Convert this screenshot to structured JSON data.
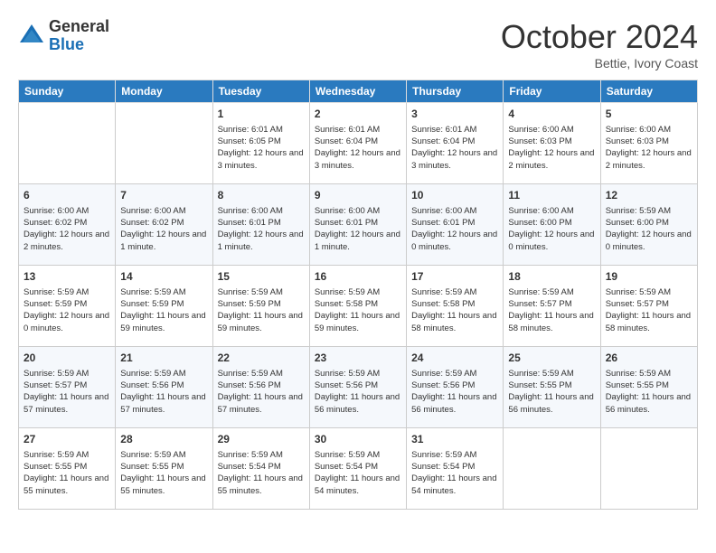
{
  "logo": {
    "general": "General",
    "blue": "Blue"
  },
  "header": {
    "month": "October 2024",
    "location": "Bettie, Ivory Coast"
  },
  "days_of_week": [
    "Sunday",
    "Monday",
    "Tuesday",
    "Wednesday",
    "Thursday",
    "Friday",
    "Saturday"
  ],
  "weeks": [
    [
      {
        "day": "",
        "info": ""
      },
      {
        "day": "",
        "info": ""
      },
      {
        "day": "1",
        "info": "Sunrise: 6:01 AM\nSunset: 6:05 PM\nDaylight: 12 hours and 3 minutes."
      },
      {
        "day": "2",
        "info": "Sunrise: 6:01 AM\nSunset: 6:04 PM\nDaylight: 12 hours and 3 minutes."
      },
      {
        "day": "3",
        "info": "Sunrise: 6:01 AM\nSunset: 6:04 PM\nDaylight: 12 hours and 3 minutes."
      },
      {
        "day": "4",
        "info": "Sunrise: 6:00 AM\nSunset: 6:03 PM\nDaylight: 12 hours and 2 minutes."
      },
      {
        "day": "5",
        "info": "Sunrise: 6:00 AM\nSunset: 6:03 PM\nDaylight: 12 hours and 2 minutes."
      }
    ],
    [
      {
        "day": "6",
        "info": "Sunrise: 6:00 AM\nSunset: 6:02 PM\nDaylight: 12 hours and 2 minutes."
      },
      {
        "day": "7",
        "info": "Sunrise: 6:00 AM\nSunset: 6:02 PM\nDaylight: 12 hours and 1 minute."
      },
      {
        "day": "8",
        "info": "Sunrise: 6:00 AM\nSunset: 6:01 PM\nDaylight: 12 hours and 1 minute."
      },
      {
        "day": "9",
        "info": "Sunrise: 6:00 AM\nSunset: 6:01 PM\nDaylight: 12 hours and 1 minute."
      },
      {
        "day": "10",
        "info": "Sunrise: 6:00 AM\nSunset: 6:01 PM\nDaylight: 12 hours and 0 minutes."
      },
      {
        "day": "11",
        "info": "Sunrise: 6:00 AM\nSunset: 6:00 PM\nDaylight: 12 hours and 0 minutes."
      },
      {
        "day": "12",
        "info": "Sunrise: 5:59 AM\nSunset: 6:00 PM\nDaylight: 12 hours and 0 minutes."
      }
    ],
    [
      {
        "day": "13",
        "info": "Sunrise: 5:59 AM\nSunset: 5:59 PM\nDaylight: 12 hours and 0 minutes."
      },
      {
        "day": "14",
        "info": "Sunrise: 5:59 AM\nSunset: 5:59 PM\nDaylight: 11 hours and 59 minutes."
      },
      {
        "day": "15",
        "info": "Sunrise: 5:59 AM\nSunset: 5:59 PM\nDaylight: 11 hours and 59 minutes."
      },
      {
        "day": "16",
        "info": "Sunrise: 5:59 AM\nSunset: 5:58 PM\nDaylight: 11 hours and 59 minutes."
      },
      {
        "day": "17",
        "info": "Sunrise: 5:59 AM\nSunset: 5:58 PM\nDaylight: 11 hours and 58 minutes."
      },
      {
        "day": "18",
        "info": "Sunrise: 5:59 AM\nSunset: 5:57 PM\nDaylight: 11 hours and 58 minutes."
      },
      {
        "day": "19",
        "info": "Sunrise: 5:59 AM\nSunset: 5:57 PM\nDaylight: 11 hours and 58 minutes."
      }
    ],
    [
      {
        "day": "20",
        "info": "Sunrise: 5:59 AM\nSunset: 5:57 PM\nDaylight: 11 hours and 57 minutes."
      },
      {
        "day": "21",
        "info": "Sunrise: 5:59 AM\nSunset: 5:56 PM\nDaylight: 11 hours and 57 minutes."
      },
      {
        "day": "22",
        "info": "Sunrise: 5:59 AM\nSunset: 5:56 PM\nDaylight: 11 hours and 57 minutes."
      },
      {
        "day": "23",
        "info": "Sunrise: 5:59 AM\nSunset: 5:56 PM\nDaylight: 11 hours and 56 minutes."
      },
      {
        "day": "24",
        "info": "Sunrise: 5:59 AM\nSunset: 5:56 PM\nDaylight: 11 hours and 56 minutes."
      },
      {
        "day": "25",
        "info": "Sunrise: 5:59 AM\nSunset: 5:55 PM\nDaylight: 11 hours and 56 minutes."
      },
      {
        "day": "26",
        "info": "Sunrise: 5:59 AM\nSunset: 5:55 PM\nDaylight: 11 hours and 56 minutes."
      }
    ],
    [
      {
        "day": "27",
        "info": "Sunrise: 5:59 AM\nSunset: 5:55 PM\nDaylight: 11 hours and 55 minutes."
      },
      {
        "day": "28",
        "info": "Sunrise: 5:59 AM\nSunset: 5:55 PM\nDaylight: 11 hours and 55 minutes."
      },
      {
        "day": "29",
        "info": "Sunrise: 5:59 AM\nSunset: 5:54 PM\nDaylight: 11 hours and 55 minutes."
      },
      {
        "day": "30",
        "info": "Sunrise: 5:59 AM\nSunset: 5:54 PM\nDaylight: 11 hours and 54 minutes."
      },
      {
        "day": "31",
        "info": "Sunrise: 5:59 AM\nSunset: 5:54 PM\nDaylight: 11 hours and 54 minutes."
      },
      {
        "day": "",
        "info": ""
      },
      {
        "day": "",
        "info": ""
      }
    ]
  ]
}
